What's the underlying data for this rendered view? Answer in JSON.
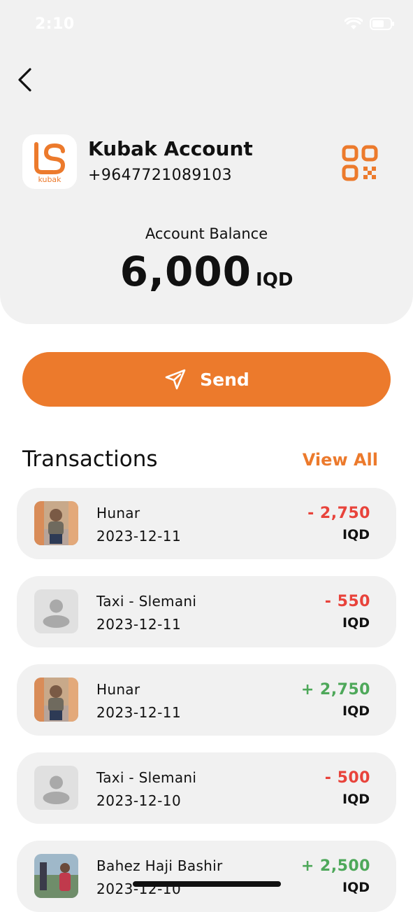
{
  "status": {
    "time": "2:10"
  },
  "account": {
    "name": "Kubak Account",
    "phone": "+9647721089103",
    "logo_text": "kubak",
    "balance_label": "Account Balance",
    "balance": "6,000",
    "currency": "IQD"
  },
  "send": {
    "label": "Send"
  },
  "transactions": {
    "title": "Transactions",
    "view_all": "View All",
    "items": [
      {
        "name": "Hunar",
        "date": "2023-12-11",
        "amount": "- 2,750",
        "currency": "IQD",
        "direction": "out",
        "avatar": "photo-child"
      },
      {
        "name": "Taxi - Slemani",
        "date": "2023-12-11",
        "amount": "- 550",
        "currency": "IQD",
        "direction": "out",
        "avatar": "default-person"
      },
      {
        "name": "Hunar",
        "date": "2023-12-11",
        "amount": "+ 2,750",
        "currency": "IQD",
        "direction": "in",
        "avatar": "photo-child"
      },
      {
        "name": "Taxi - Slemani",
        "date": "2023-12-10",
        "amount": "- 500",
        "currency": "IQD",
        "direction": "out",
        "avatar": "default-person"
      },
      {
        "name": "Bahez Haji Bashir",
        "date": "2023-12-10",
        "amount": "+ 2,500",
        "currency": "IQD",
        "direction": "in",
        "avatar": "photo-outdoor"
      }
    ]
  },
  "colors": {
    "accent": "#ec7a2c",
    "negative": "#e8433b",
    "positive": "#4ea85a",
    "card": "#f1f1f1"
  }
}
